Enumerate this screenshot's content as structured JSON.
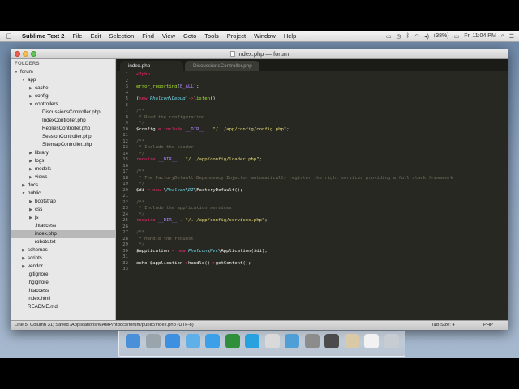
{
  "menubar": {
    "app_name": "Sublime Text 2",
    "items": [
      "File",
      "Edit",
      "Selection",
      "Find",
      "View",
      "Goto",
      "Tools",
      "Project",
      "Window",
      "Help"
    ],
    "battery": "(38%)",
    "clock": "Fri 11:04 PM"
  },
  "window": {
    "title": "index.php — forum"
  },
  "sidebar": {
    "header": "FOLDERS",
    "tree": [
      {
        "label": "forum",
        "depth": 0,
        "arrow": "▼"
      },
      {
        "label": "app",
        "depth": 1,
        "arrow": "▼"
      },
      {
        "label": "cache",
        "depth": 2,
        "arrow": "▶"
      },
      {
        "label": "config",
        "depth": 2,
        "arrow": "▶"
      },
      {
        "label": "controllers",
        "depth": 2,
        "arrow": "▼"
      },
      {
        "label": "DiscussionsController.php",
        "depth": 3,
        "arrow": ""
      },
      {
        "label": "IndexController.php",
        "depth": 3,
        "arrow": ""
      },
      {
        "label": "RepliesController.php",
        "depth": 3,
        "arrow": ""
      },
      {
        "label": "SessionController.php",
        "depth": 3,
        "arrow": ""
      },
      {
        "label": "SitemapController.php",
        "depth": 3,
        "arrow": ""
      },
      {
        "label": "library",
        "depth": 2,
        "arrow": "▶"
      },
      {
        "label": "logs",
        "depth": 2,
        "arrow": "▶"
      },
      {
        "label": "models",
        "depth": 2,
        "arrow": "▶"
      },
      {
        "label": "views",
        "depth": 2,
        "arrow": "▶"
      },
      {
        "label": "docs",
        "depth": 1,
        "arrow": "▶"
      },
      {
        "label": "public",
        "depth": 1,
        "arrow": "▼"
      },
      {
        "label": "bootstrap",
        "depth": 2,
        "arrow": "▶"
      },
      {
        "label": "css",
        "depth": 2,
        "arrow": "▶"
      },
      {
        "label": "js",
        "depth": 2,
        "arrow": "▶"
      },
      {
        "label": ".htaccess",
        "depth": 2,
        "arrow": ""
      },
      {
        "label": "index.php",
        "depth": 2,
        "arrow": "",
        "selected": true
      },
      {
        "label": "robots.txt",
        "depth": 2,
        "arrow": ""
      },
      {
        "label": "schemas",
        "depth": 1,
        "arrow": "▶"
      },
      {
        "label": "scripts",
        "depth": 1,
        "arrow": "▶"
      },
      {
        "label": "vendor",
        "depth": 1,
        "arrow": "▶"
      },
      {
        "label": ".gitignore",
        "depth": 1,
        "arrow": ""
      },
      {
        "label": ".hgignore",
        "depth": 1,
        "arrow": ""
      },
      {
        "label": ".htaccess",
        "depth": 1,
        "arrow": ""
      },
      {
        "label": "index.html",
        "depth": 1,
        "arrow": ""
      },
      {
        "label": "README.md",
        "depth": 1,
        "arrow": ""
      }
    ]
  },
  "tabs": [
    {
      "label": "index.php",
      "active": true
    },
    {
      "label": "DiscussionsController.php",
      "active": false
    }
  ],
  "code": {
    "lines": [
      [
        [
          "kw",
          "<?php"
        ]
      ],
      [],
      [
        [
          "fn",
          "error_reporting"
        ],
        [
          "var",
          "("
        ],
        [
          "cst",
          "E_ALL"
        ],
        [
          "var",
          ");"
        ]
      ],
      [],
      [
        [
          "var",
          "("
        ],
        [
          "kw",
          "new "
        ],
        [
          "cls",
          "Phalcon"
        ],
        [
          "var",
          "\\"
        ],
        [
          "cls",
          "Debug"
        ],
        [
          "var",
          ")"
        ],
        [
          "kw",
          "->"
        ],
        [
          "fn",
          "listen"
        ],
        [
          "var",
          "();"
        ]
      ],
      [],
      [
        [
          "cm",
          "/**"
        ]
      ],
      [
        [
          "cm",
          " * Read the configuration"
        ]
      ],
      [
        [
          "cm",
          " */"
        ]
      ],
      [
        [
          "var",
          "$config "
        ],
        [
          "kw",
          "= include "
        ],
        [
          "cst",
          "__DIR__"
        ],
        [
          "kw",
          " . "
        ],
        [
          "str",
          "\"/../app/config/config.php\""
        ],
        [
          "var",
          ";"
        ]
      ],
      [],
      [
        [
          "cm",
          "/**"
        ]
      ],
      [
        [
          "cm",
          " * Include the loader"
        ]
      ],
      [
        [
          "cm",
          " */"
        ]
      ],
      [
        [
          "kw",
          "require "
        ],
        [
          "cst",
          "__DIR__"
        ],
        [
          "kw",
          " . "
        ],
        [
          "str",
          "\"/../app/config/loader.php\""
        ],
        [
          "var",
          ";"
        ]
      ],
      [],
      [
        [
          "cm",
          "/**"
        ]
      ],
      [
        [
          "cm",
          " * The FactoryDefault Dependency Injector automatically register the right services providing a full stack framework"
        ]
      ],
      [
        [
          "cm",
          " */"
        ]
      ],
      [
        [
          "var",
          "$di "
        ],
        [
          "kw",
          "= new "
        ],
        [
          "var",
          "\\"
        ],
        [
          "cls",
          "Phalcon"
        ],
        [
          "var",
          "\\"
        ],
        [
          "cls",
          "DI"
        ],
        [
          "var",
          "\\FactoryDefault();"
        ]
      ],
      [],
      [
        [
          "cm",
          "/**"
        ]
      ],
      [
        [
          "cm",
          " * Include the application services"
        ]
      ],
      [
        [
          "cm",
          " */"
        ]
      ],
      [
        [
          "kw",
          "require "
        ],
        [
          "cst",
          "__DIR__"
        ],
        [
          "kw",
          " . "
        ],
        [
          "str",
          "\"/../app/config/services.php\""
        ],
        [
          "var",
          ";"
        ]
      ],
      [],
      [
        [
          "cm",
          "/**"
        ]
      ],
      [
        [
          "cm",
          " * Handle the request"
        ]
      ],
      [
        [
          "cm",
          " */"
        ]
      ],
      [
        [
          "var",
          "$application "
        ],
        [
          "kw",
          "= new "
        ],
        [
          "cls",
          "Phalcon"
        ],
        [
          "var",
          "\\"
        ],
        [
          "cls",
          "Mvc"
        ],
        [
          "var",
          "\\Application($di);"
        ]
      ],
      [],
      [
        [
          "var",
          "echo $application"
        ],
        [
          "kw",
          "->"
        ],
        [
          "var",
          "handle()"
        ],
        [
          "kw",
          "->"
        ],
        [
          "var",
          "getContent();"
        ]
      ],
      []
    ]
  },
  "statusbar": {
    "left": "Line 5, Column 31; Saved /Applications/MAMP/htdocs/forum/public/index.php (UTF-8)",
    "tab_size": "Tab Size: 4",
    "syntax": "PHP"
  },
  "dock": {
    "icons": [
      {
        "name": "finder-icon",
        "color": "#4a90d9"
      },
      {
        "name": "launchpad-icon",
        "color": "#9aa4ad"
      },
      {
        "name": "app-store-icon",
        "color": "#3d8fe0"
      },
      {
        "name": "safari-icon",
        "color": "#5fb0e8"
      },
      {
        "name": "itunes-icon",
        "color": "#3ba0e8"
      },
      {
        "name": "spotify-icon",
        "color": "#2f8f3a"
      },
      {
        "name": "skype-icon",
        "color": "#27a1e0"
      },
      {
        "name": "chrome-icon",
        "color": "#d9d9d9"
      },
      {
        "name": "globe-icon",
        "color": "#4f9fd6"
      },
      {
        "name": "system-preferences-icon",
        "color": "#8c8c8c"
      },
      {
        "name": "sublime-text-icon",
        "color": "#4b4b4b"
      },
      {
        "name": "documents-icon",
        "color": "#d9c9a7"
      },
      {
        "name": "file-icon",
        "color": "#f2f2f2"
      },
      {
        "name": "trash-icon",
        "color": "#c7ccd2"
      }
    ]
  }
}
